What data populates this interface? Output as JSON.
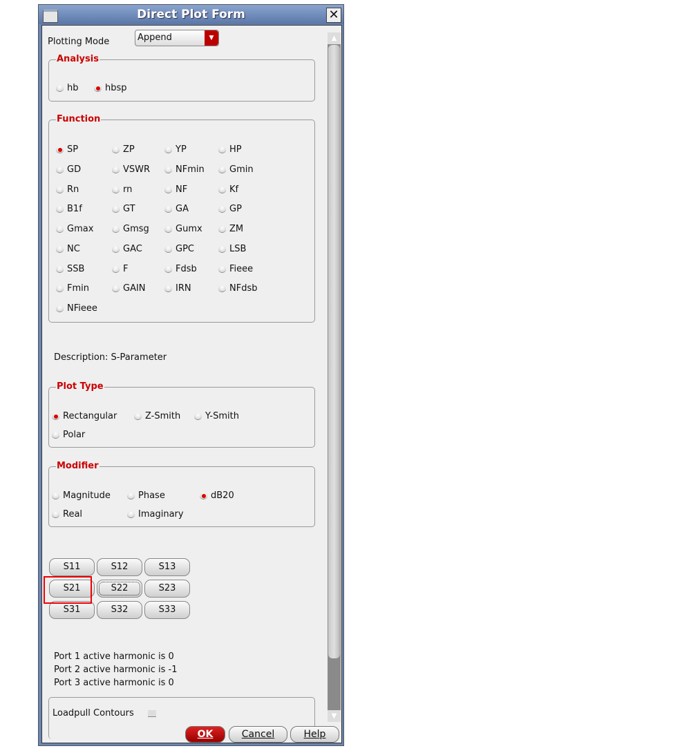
{
  "window": {
    "title": "Direct Plot Form"
  },
  "plotting_mode": {
    "label": "Plotting Mode",
    "value": "Append"
  },
  "analysis": {
    "title": "Analysis",
    "options": [
      {
        "label": "hb",
        "selected": false
      },
      {
        "label": "hbsp",
        "selected": true
      }
    ]
  },
  "function": {
    "title": "Function",
    "options": [
      "SP",
      "ZP",
      "YP",
      "HP",
      "GD",
      "VSWR",
      "NFmin",
      "Gmin",
      "Rn",
      "rn",
      "NF",
      "Kf",
      "B1f",
      "GT",
      "GA",
      "GP",
      "Gmax",
      "Gmsg",
      "Gumx",
      "ZM",
      "NC",
      "GAC",
      "GPC",
      "LSB",
      "SSB",
      "F",
      "Fdsb",
      "Fieee",
      "Fmin",
      "GAIN",
      "IRN",
      "NFdsb",
      "NFieee"
    ],
    "selected": "SP"
  },
  "description": "Description: S-Parameter",
  "plot_type": {
    "title": "Plot Type",
    "options": [
      {
        "label": "Rectangular",
        "selected": true
      },
      {
        "label": "Z-Smith",
        "selected": false
      },
      {
        "label": "Y-Smith",
        "selected": false
      },
      {
        "label": "Polar",
        "selected": false
      }
    ]
  },
  "modifier": {
    "title": "Modifier",
    "options": [
      {
        "label": "Magnitude",
        "selected": false
      },
      {
        "label": "Phase",
        "selected": false
      },
      {
        "label": "dB20",
        "selected": true
      },
      {
        "label": "Real",
        "selected": false
      },
      {
        "label": "Imaginary",
        "selected": false
      }
    ]
  },
  "s_buttons": [
    "S11",
    "S12",
    "S13",
    "S21",
    "S22",
    "S23",
    "S31",
    "S32",
    "S33"
  ],
  "ports": [
    "Port 1 active harmonic is 0",
    "Port 2 active harmonic is -1",
    "Port 3 active harmonic is 0"
  ],
  "loadpull": {
    "label": "Loadpull Contours",
    "checked": false
  },
  "buttons": {
    "ok": "OK",
    "cancel": "Cancel",
    "help": "Help"
  },
  "colors": {
    "accent": "#cc0000",
    "title_bar": "#6a86b4"
  }
}
